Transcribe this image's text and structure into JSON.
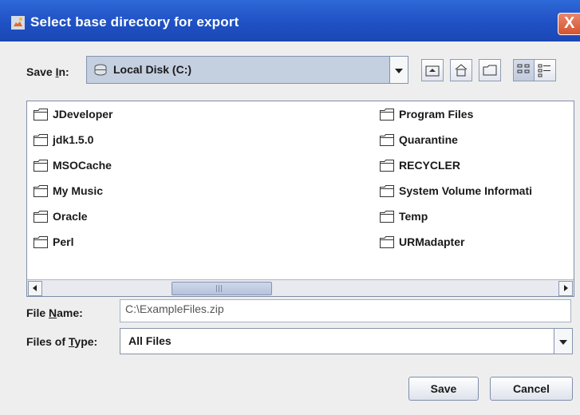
{
  "window": {
    "title": "Select base directory for export",
    "close_label": "X"
  },
  "save_in": {
    "label_pre": "Save ",
    "label_mnemonic": "I",
    "label_post": "n:",
    "value": "Local Disk (C:)"
  },
  "toolbar": [
    "up-one-level-icon",
    "home-icon",
    "new-folder-icon",
    "list-view-icon",
    "details-view-icon"
  ],
  "files": [
    {
      "name": "JDeveloper"
    },
    {
      "name": "jdk1.5.0"
    },
    {
      "name": "MSOCache"
    },
    {
      "name": "My Music"
    },
    {
      "name": "Oracle"
    },
    {
      "name": "Perl"
    },
    {
      "name": "Program Files"
    },
    {
      "name": "Quarantine"
    },
    {
      "name": "RECYCLER"
    },
    {
      "name": "System Volume Informati"
    },
    {
      "name": "Temp"
    },
    {
      "name": "URMadapter"
    }
  ],
  "file_name": {
    "label_pre": "File ",
    "label_mnemonic": "N",
    "label_post": "ame:",
    "value": "C:\\ExampleFiles.zip"
  },
  "file_type": {
    "label_pre": "Files of ",
    "label_mnemonic": "T",
    "label_post": "ype:",
    "value": "All Files"
  },
  "buttons": {
    "save": "Save",
    "cancel": "Cancel"
  }
}
